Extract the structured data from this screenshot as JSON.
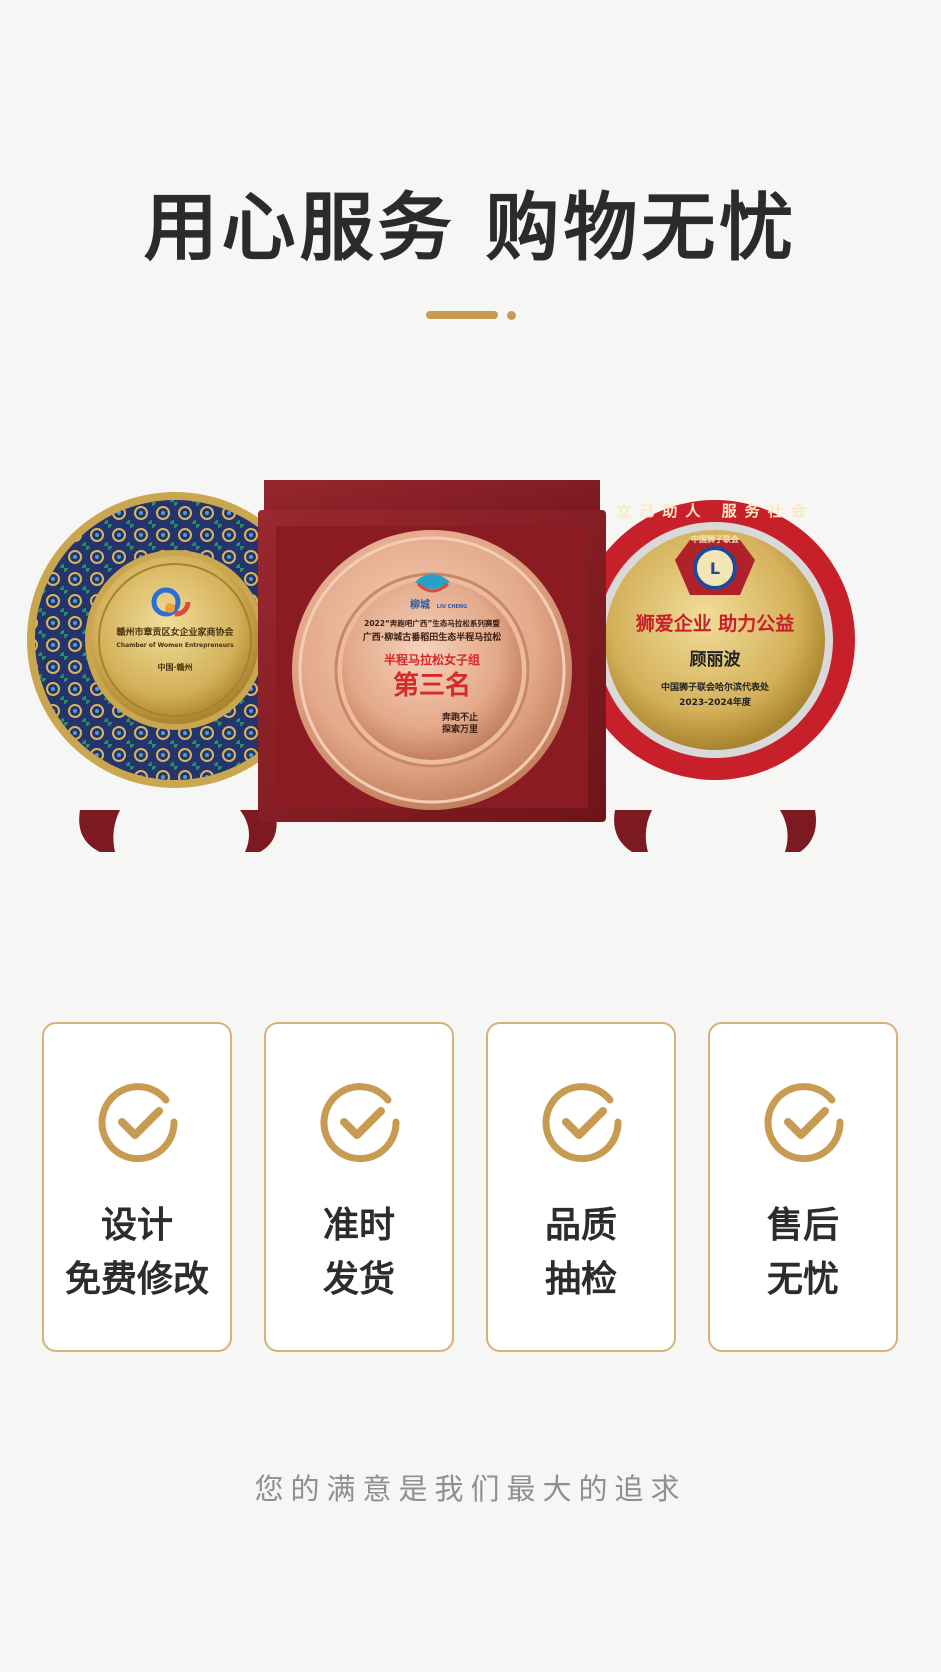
{
  "headline": "用心服务 购物无忧",
  "product_image": {
    "left_plate": {
      "org": "赣州市章贡区女企业家商协会",
      "org_en": "Chamber of Women Entrepreneurs",
      "place": "中国·赣州"
    },
    "center_plate": {
      "logo_cn": "柳城",
      "logo_en": "LIU CHENG",
      "line1": "2022“奔跑吧广西”生态马拉松系列赛暨",
      "line2": "广西·柳城古番稻田生态半程马拉松",
      "category": "半程马拉松女子组",
      "award": "第三名",
      "slogan1": "奔跑不止",
      "slogan2": "探索万里"
    },
    "right_plate": {
      "ring_text": "立己助人 服务社会",
      "emblem_top": "中国狮子联会",
      "slogan": "狮爱企业  助力公益",
      "name": "顾丽波",
      "org": "中国狮子联会哈尔滨代表处",
      "year": "2023-2024年度"
    }
  },
  "features": [
    {
      "line1": "设计",
      "line2": "免费修改",
      "icon": "checkmark-circle-icon"
    },
    {
      "line1": "准时",
      "line2": "发货",
      "icon": "checkmark-circle-icon"
    },
    {
      "line1": "品质",
      "line2": "抽检",
      "icon": "checkmark-circle-icon"
    },
    {
      "line1": "售后",
      "line2": "无忧",
      "icon": "checkmark-circle-icon"
    }
  ],
  "tagline": "您的满意是我们最大的追求",
  "colors": {
    "accent": "#c89b52",
    "card_border": "#d5b27a",
    "box_red": "#8e1f26",
    "plate_red": "#c8202a",
    "plate_blue": "#24346d"
  }
}
